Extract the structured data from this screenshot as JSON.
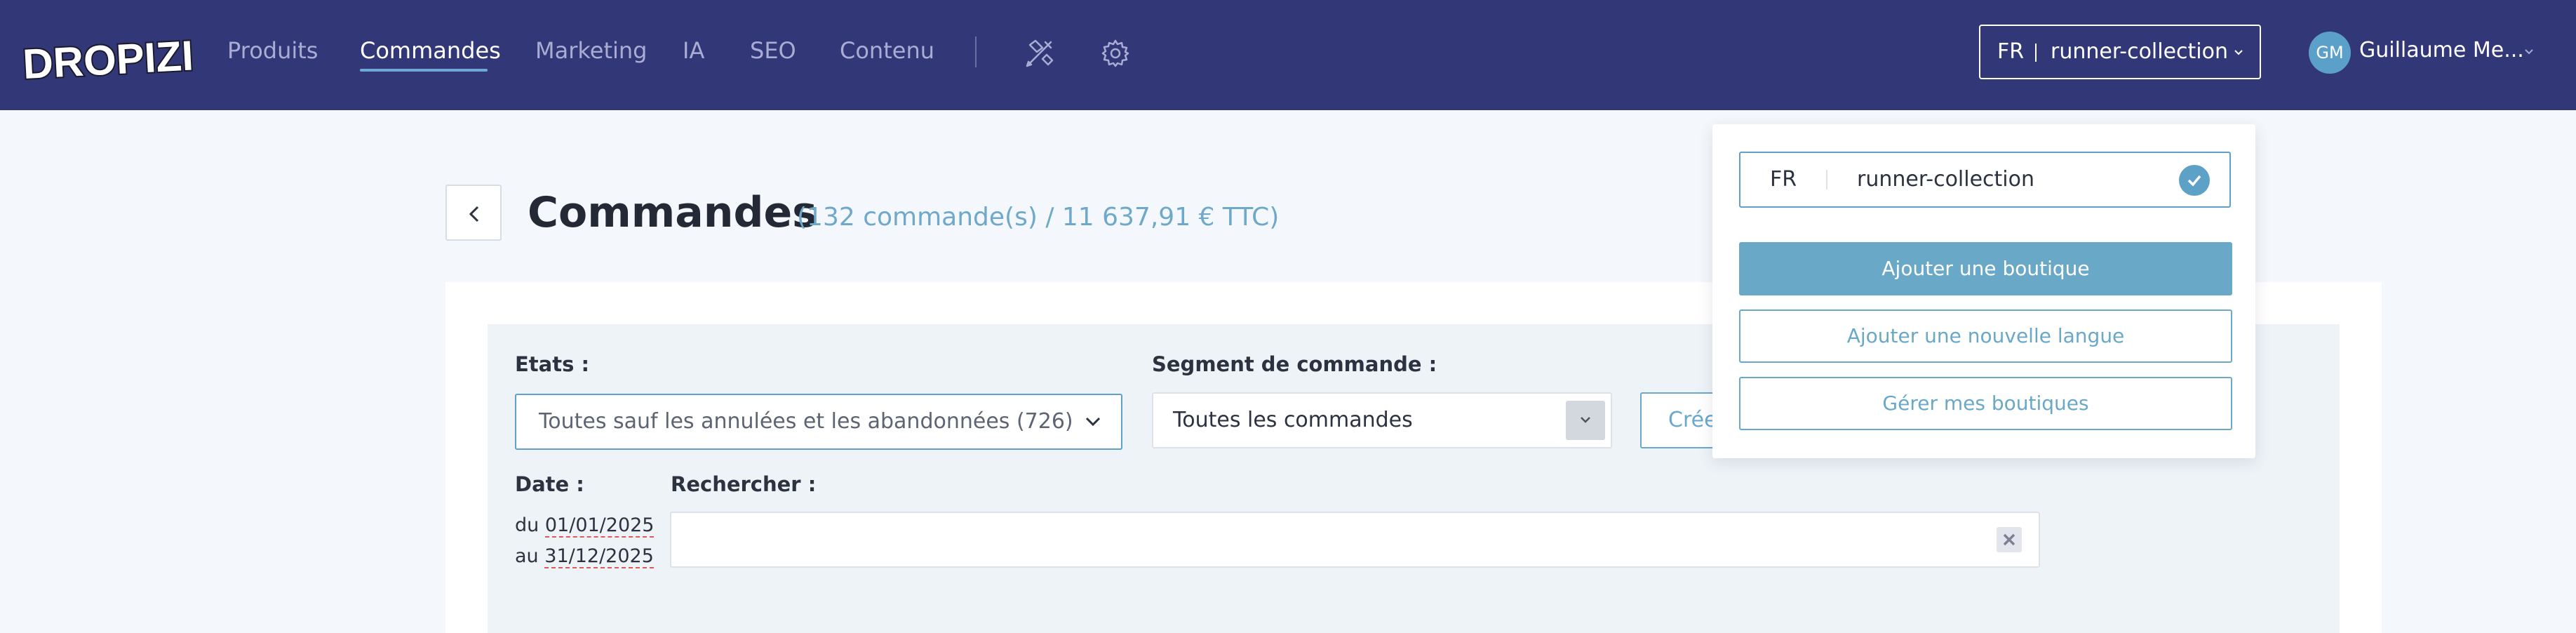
{
  "header": {
    "logo_text": "DROPIZI",
    "nav": [
      "Produits",
      "Commandes",
      "Marketing",
      "IA",
      "SEO",
      "Contenu"
    ],
    "active_nav": "Commandes",
    "shop_selector": {
      "lang": "FR",
      "shop": "runner-collection"
    },
    "user": {
      "initials": "GM",
      "name": "Guillaume Me..."
    }
  },
  "page": {
    "title": "Commandes",
    "summary": "(132 commande(s) / 11 637,91 €  TTC)"
  },
  "filters": {
    "states_label": "Etats :",
    "states_value": "Toutes sauf les annulées et les abandonnées (726)",
    "segment_label": "Segment de commande :",
    "segment_value": "Toutes les commandes",
    "create_button": "Crée",
    "date_label": "Date :",
    "date_from_prefix": "du",
    "date_from": "01/01/2025",
    "date_to_prefix": "au",
    "date_to": "31/12/2025",
    "search_label": "Rechercher :",
    "search_value": ""
  },
  "shop_dropdown": {
    "current": {
      "lang": "FR",
      "shop": "runner-collection"
    },
    "add_shop": "Ajouter une boutique",
    "add_language": "Ajouter une nouvelle langue",
    "manage_shops": "Gérer mes boutiques"
  },
  "colors": {
    "topbar": "#323777",
    "accent": "#6aa8c8",
    "page_bg": "#f4f7fb"
  }
}
